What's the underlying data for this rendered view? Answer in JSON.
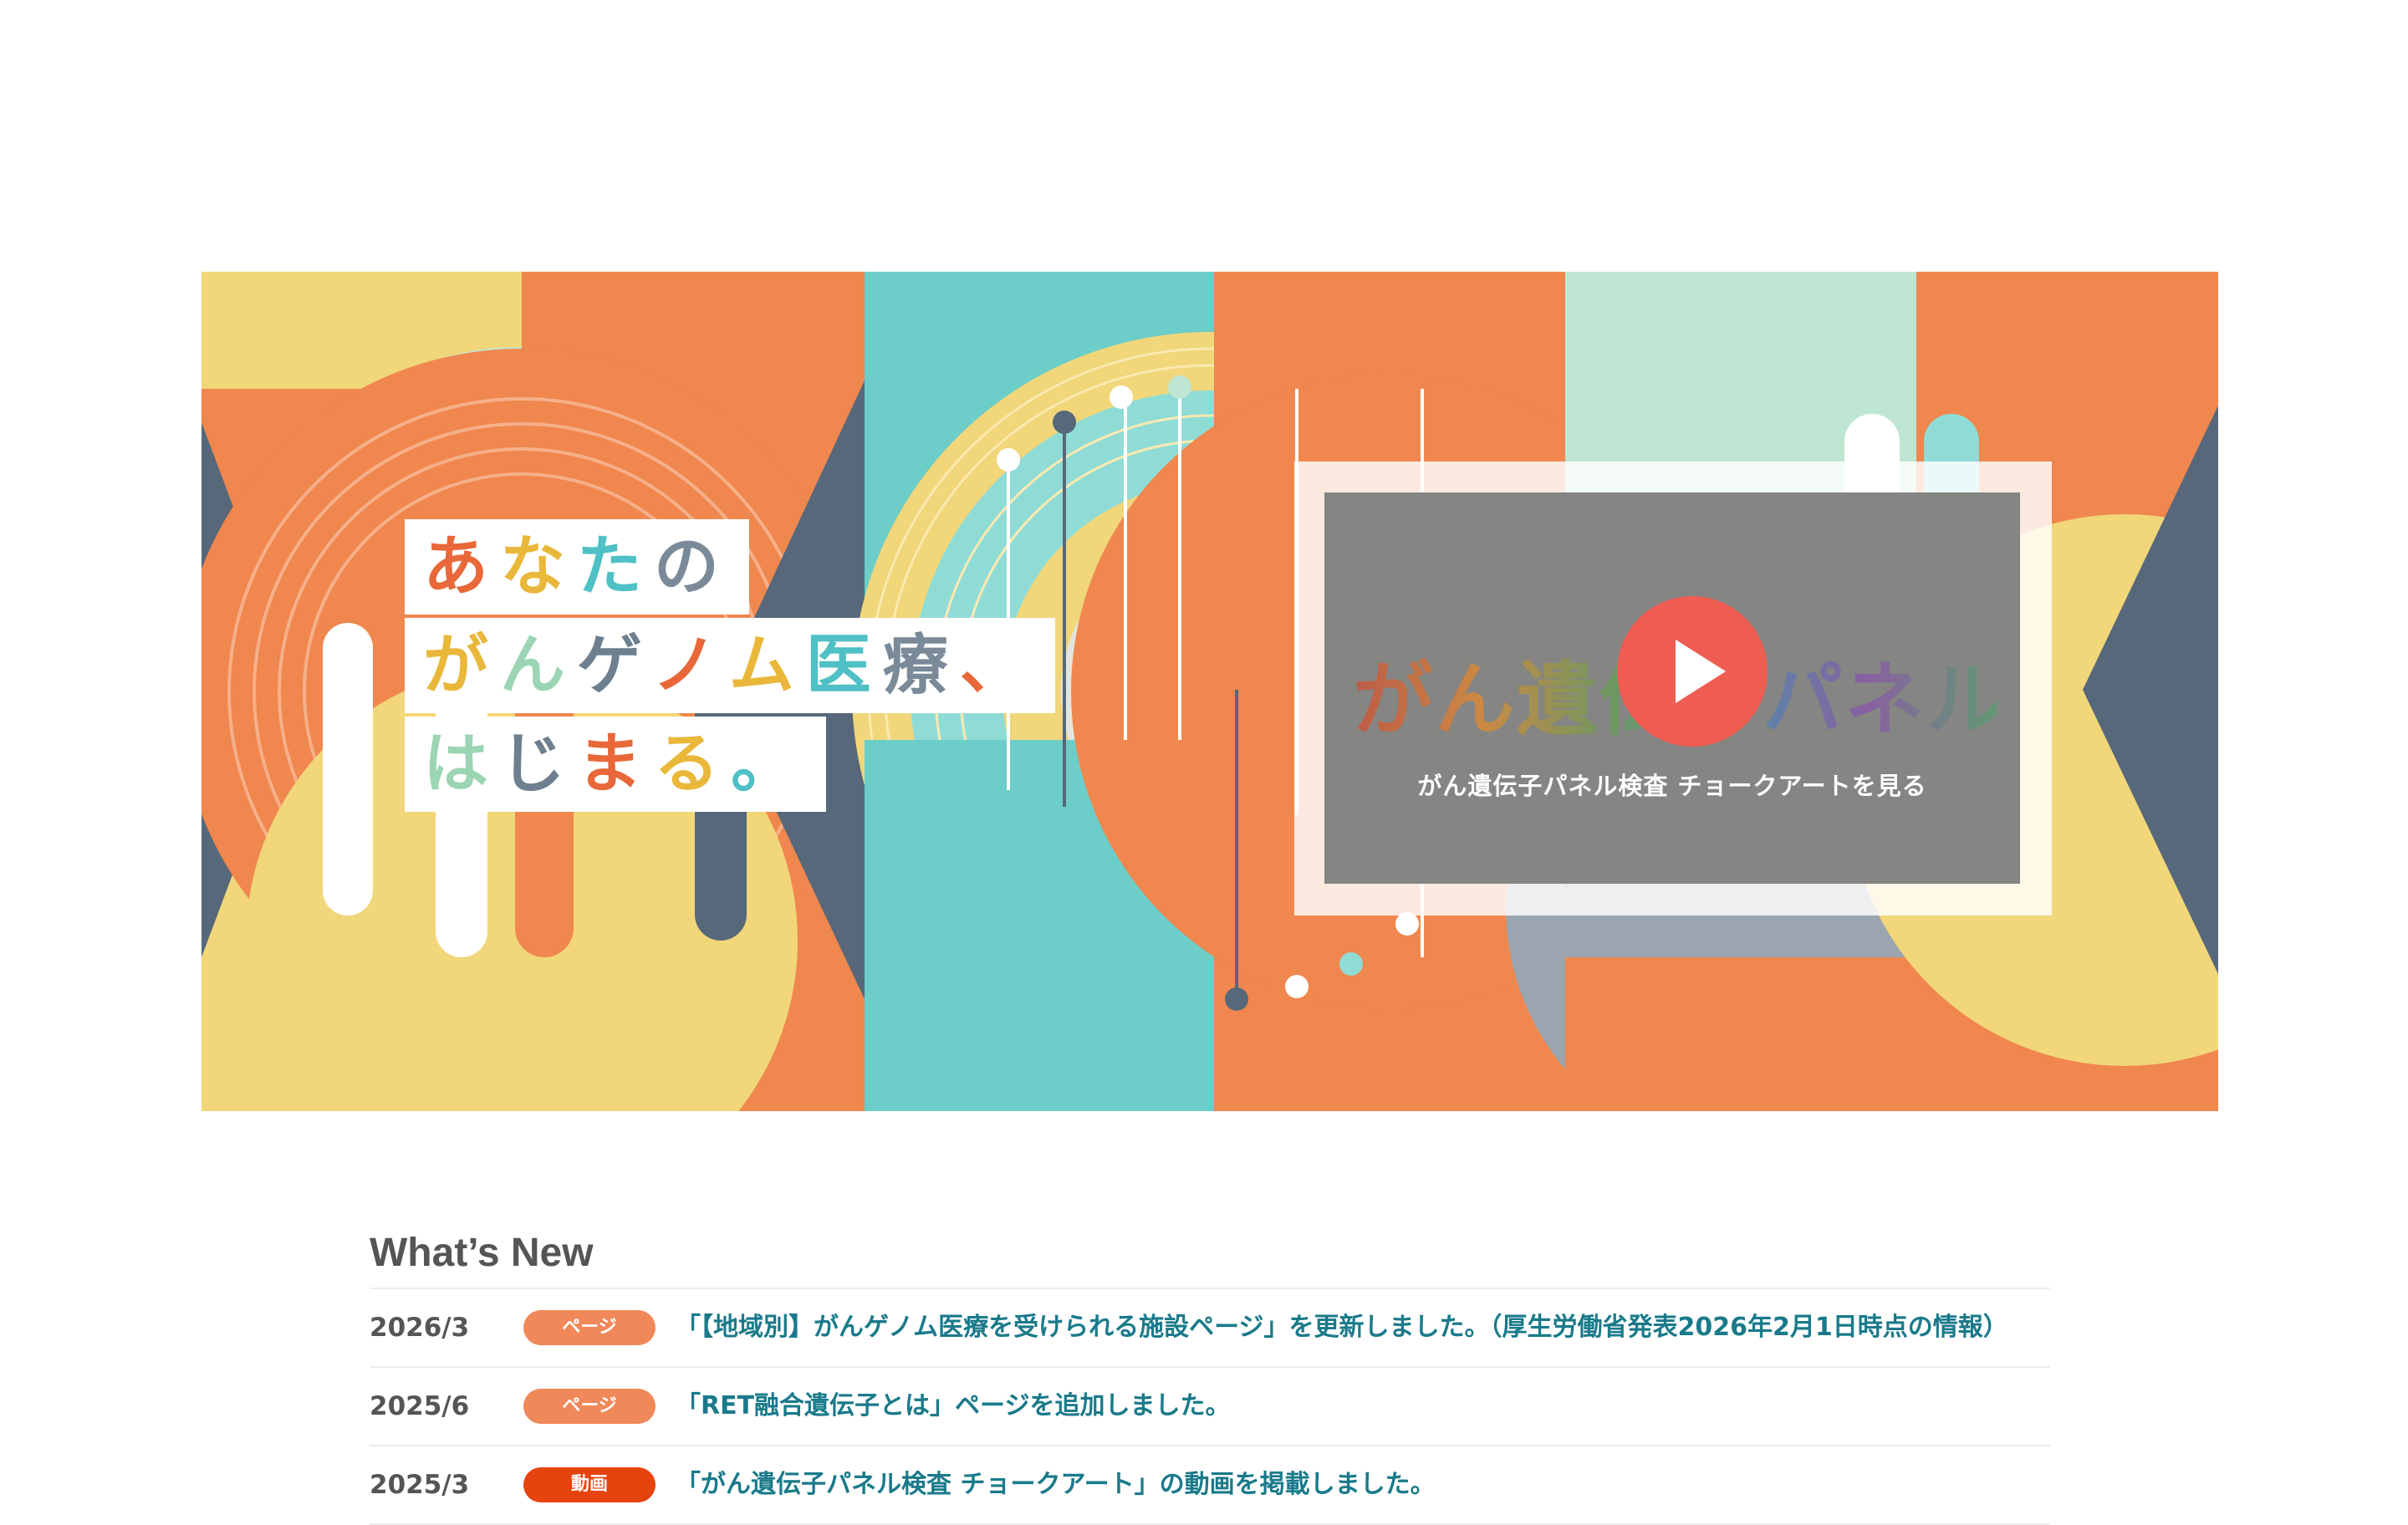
{
  "hero": {
    "tagline": [
      [
        {
          "ch": "あ",
          "color": "#e8683a"
        },
        {
          "ch": "な",
          "color": "#e9b83a"
        },
        {
          "ch": "た",
          "color": "#4fc0c5"
        },
        {
          "ch": "の",
          "color": "#7a8a99"
        }
      ],
      [
        {
          "ch": "が",
          "color": "#e9b83a"
        },
        {
          "ch": "ん",
          "color": "#9bd5b3"
        },
        {
          "ch": "ゲ",
          "color": "#6e7f8f"
        },
        {
          "ch": "ノ",
          "color": "#e8683a"
        },
        {
          "ch": "ム",
          "color": "#e9b83a"
        },
        {
          "ch": "医",
          "color": "#4fc0c5"
        },
        {
          "ch": "療",
          "color": "#7a8a99"
        },
        {
          "ch": "、",
          "color": "#e8683a"
        }
      ],
      [
        {
          "ch": "は",
          "color": "#9bd5b3"
        },
        {
          "ch": "じ",
          "color": "#6e7f8f"
        },
        {
          "ch": "ま",
          "color": "#e8683a"
        },
        {
          "ch": "る",
          "color": "#e9b83a"
        },
        {
          "ch": "。",
          "color": "#4fc0c5"
        }
      ]
    ],
    "video": {
      "title": "がん遺伝子パネル検査",
      "subtitle": "がん遺伝子パネル検査 チョークアートを見る"
    },
    "colors": {
      "orange": "#f0874e",
      "yellow": "#f1d67a",
      "teal": "#6ccdc9",
      "mint": "#bfe6d2",
      "slate": "#57687a",
      "gray": "#9aa5b0",
      "play": "#ef5d52"
    }
  },
  "news": {
    "heading": "What’s New",
    "items": [
      {
        "date": "2026/3",
        "badge": "ページ",
        "badge_kind": "page",
        "text": "「【地域別】がんゲノム医療を受けられる施設ページ」を更新しました。（厚生労働省発表2026年2月1日時点の情報）"
      },
      {
        "date": "2025/6",
        "badge": "ページ",
        "badge_kind": "page",
        "text": "「RET融合遺伝子とは」ページを追加しました。"
      },
      {
        "date": "2025/3",
        "badge": "動画",
        "badge_kind": "video",
        "text": "「がん遺伝子パネル検査 チョークアート」の動画を掲載しました。"
      }
    ]
  }
}
